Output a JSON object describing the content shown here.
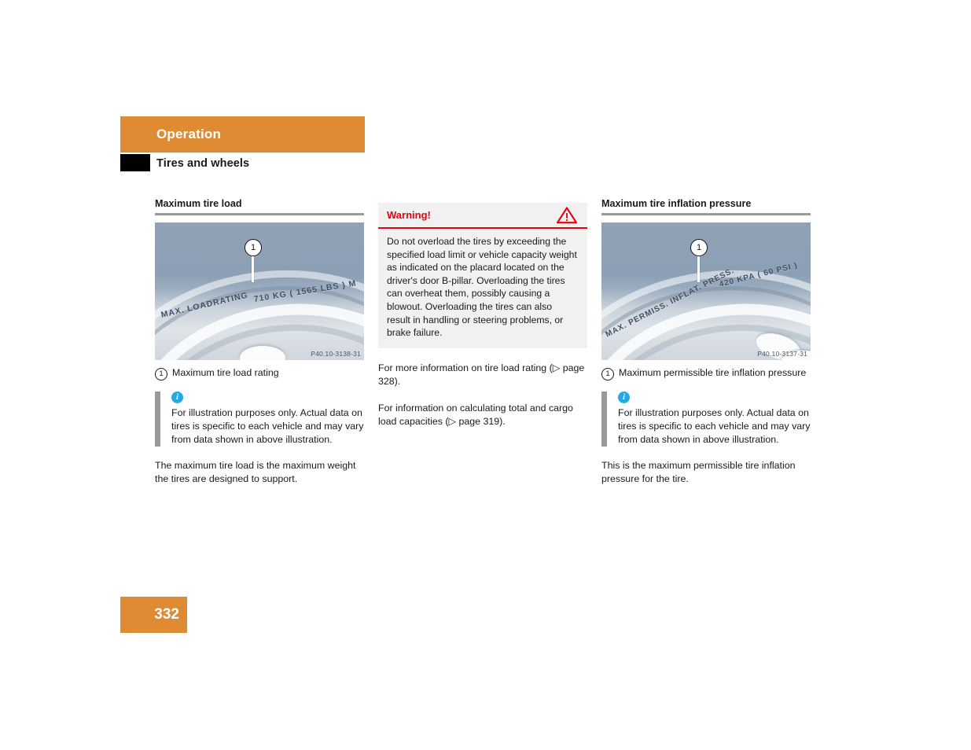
{
  "header": {
    "chapter": "Operation",
    "section": "Tires and wheels"
  },
  "columns": {
    "left": {
      "heading": "Maximum tire load",
      "figure": {
        "sidewall_text_left": "MAX. LOADRATING",
        "sidewall_text_right": "710 KG  ( 1565 LBS )  M",
        "callout_number": "1",
        "image_id": "P40.10-3138-31"
      },
      "legend": {
        "number": "1",
        "text": "Maximum tire load rating"
      },
      "note": {
        "icon": "info-icon",
        "text": "For illustration purposes only. Actual data on tires is specific to each vehicle and may vary from data shown in above illustration."
      },
      "paragraph": "The maximum tire load is the maximum weight the tires are designed to support."
    },
    "middle": {
      "warning": {
        "title": "Warning!",
        "icon": "warning-triangle-icon",
        "text": "Do not overload the tires by exceeding the specified load limit or vehicle capacity weight as indicated on the placard located on the driver's door B-pillar. Overloading the tires can overheat them, possibly causing a blowout. Overloading the tires can also result in handling or steering problems, or brake failure."
      },
      "xref_1": "For more information on tire load rating (▷ page 328).",
      "xref_2": "For information on calculating total and cargo load capacities (▷ page 319)."
    },
    "right": {
      "heading": "Maximum tire inflation pressure",
      "figure": {
        "sidewall_text_left": "MAX. PERMISS. INFLAT. PRESS.",
        "sidewall_text_right": "420 KPA  ( 60 PSI )",
        "callout_number": "1",
        "image_id": "P40.10-3137-31"
      },
      "legend": {
        "number": "1",
        "text": "Maximum permissible tire inflation pressure"
      },
      "note": {
        "icon": "info-icon",
        "text": "For illustration purposes only. Actual data on tires is specific to each vehicle and may vary from data shown in above illustration."
      },
      "paragraph": "This is the maximum permissible tire inflation pressure for the tire."
    }
  },
  "footer": {
    "page_number": "332"
  },
  "colors": {
    "accent_orange": "#df8b33",
    "warning_red": "#e8000d",
    "info_blue": "#29a8e0",
    "rule_gray": "#9a9a9a",
    "warning_bg": "#f1f1f1"
  }
}
